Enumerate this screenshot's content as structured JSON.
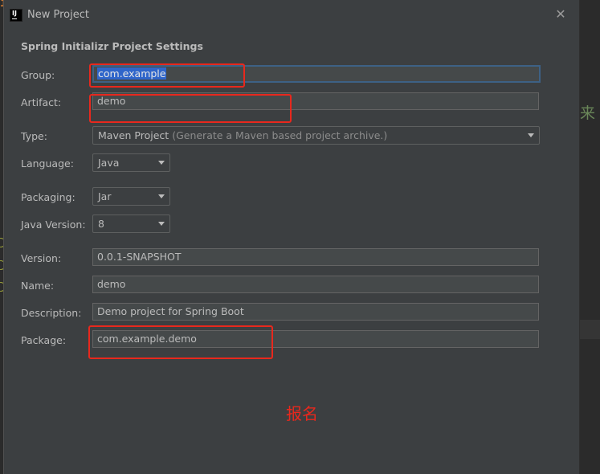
{
  "background": {
    "code_fragment": "import",
    "cjk_fragment": "来"
  },
  "dialog": {
    "title": "New Project",
    "heading": "Spring Initializr Project Settings"
  },
  "form": {
    "group": {
      "label": "Group:",
      "value": "com.example"
    },
    "artifact": {
      "label": "Artifact:",
      "value": "demo"
    },
    "type": {
      "label": "Type:",
      "value": "Maven Project",
      "hint": "(Generate a Maven based project archive.)"
    },
    "language": {
      "label": "Language:",
      "value": "Java"
    },
    "packaging": {
      "label": "Packaging:",
      "value": "Jar"
    },
    "java_version": {
      "label": "Java Version:",
      "value": "8"
    },
    "version": {
      "label": "Version:",
      "value": "0.0.1-SNAPSHOT"
    },
    "name": {
      "label": "Name:",
      "value": "demo"
    },
    "description": {
      "label": "Description:",
      "value": "Demo project for Spring Boot"
    },
    "package": {
      "label": "Package:",
      "value": "com.example.demo"
    }
  },
  "annotation": {
    "text": "报名",
    "color": "#e8281d"
  },
  "colors": {
    "dialog_bg": "#3c3f41",
    "field_bg": "#45494a",
    "focus_border": "#3d6185",
    "selection": "#2f65ca",
    "annotation_red": "#e8281d"
  }
}
